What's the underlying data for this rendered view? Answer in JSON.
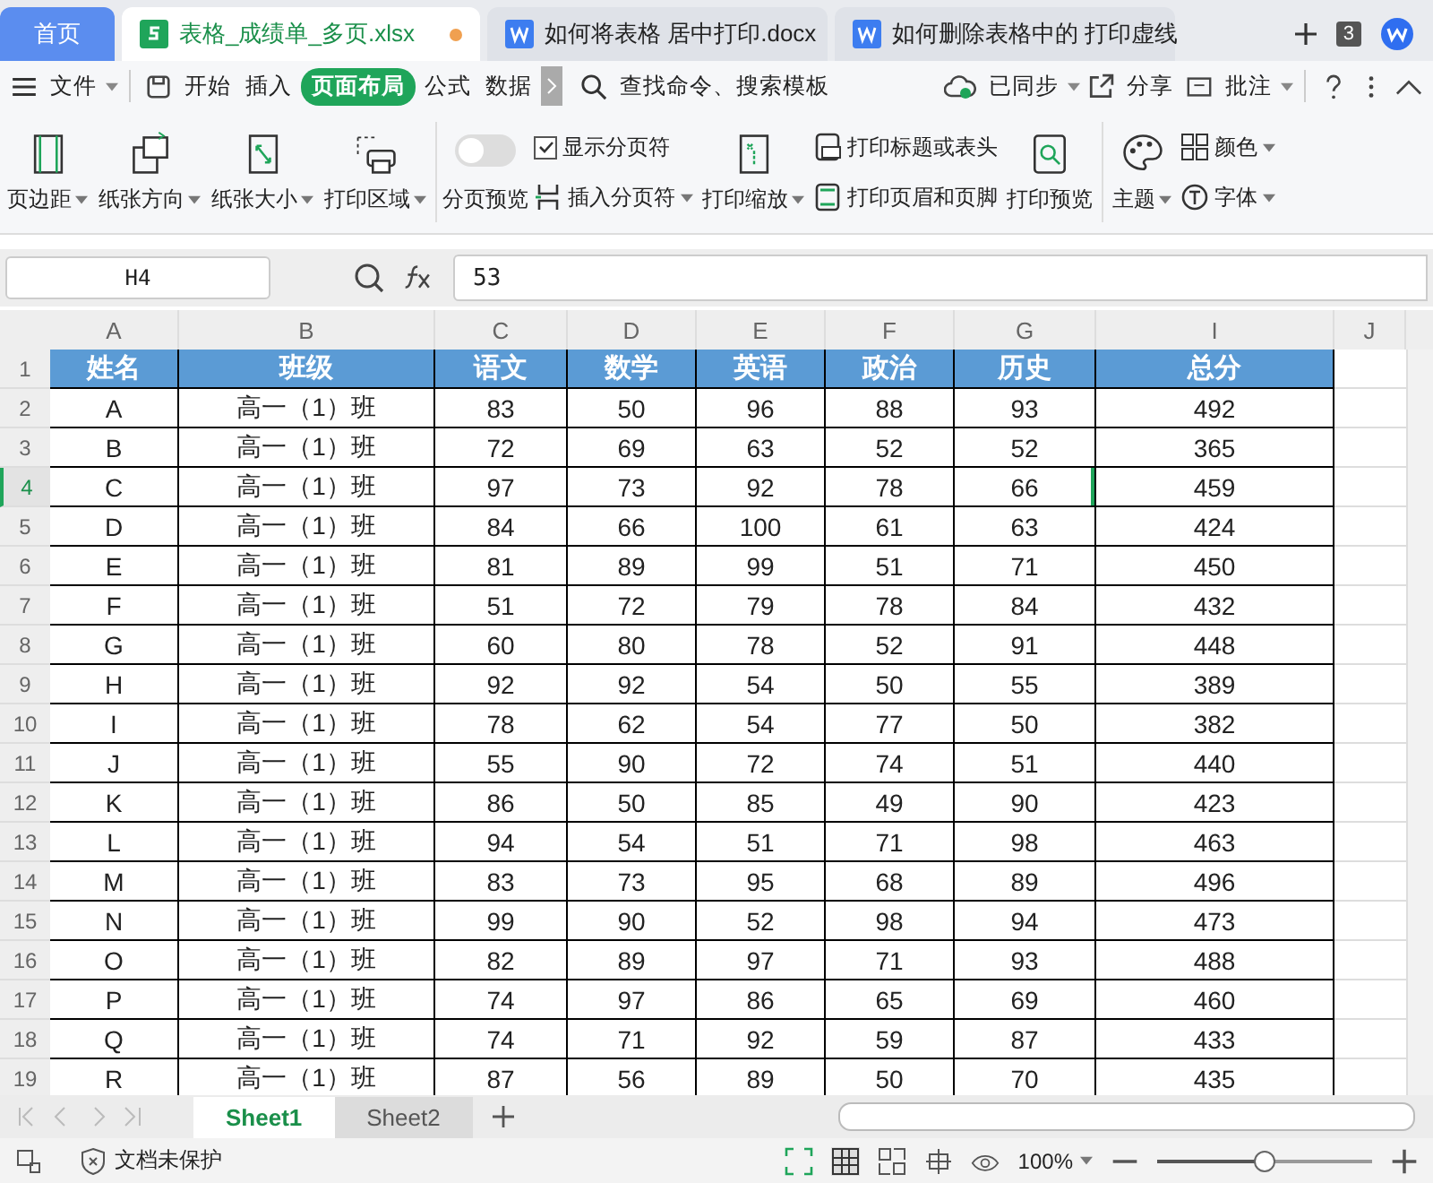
{
  "tabs": [
    {
      "label": "首页",
      "kind": "home",
      "selected": false,
      "modified": false
    },
    {
      "label": "表格_成绩单_多页.xlsx",
      "kind": "sheet",
      "selected": true,
      "modified": true
    },
    {
      "label": "如何将表格 居中打印.docx",
      "kind": "doc",
      "selected": false,
      "modified": false
    },
    {
      "label": "如何删除表格中的 打印虚线",
      "kind": "doc",
      "selected": false,
      "modified": false
    }
  ],
  "window_count": "3",
  "menu": {
    "file": "文件",
    "items": [
      {
        "label": "开始",
        "selected": false
      },
      {
        "label": "插入",
        "selected": false
      },
      {
        "label": "页面布局",
        "selected": true
      },
      {
        "label": "公式",
        "selected": false
      },
      {
        "label": "数据",
        "selected": false
      }
    ],
    "search": "查找命令、搜索模板",
    "sync": "已同步",
    "share": "分享",
    "comment": "批注"
  },
  "ribbon": {
    "page_setup": [
      "页边距",
      "纸张方向",
      "纸张大小",
      "打印区域"
    ],
    "page_break_preview": {
      "label": "分页预览",
      "on": false
    },
    "show_page_breaks": {
      "label": "显示分页符",
      "checked": true
    },
    "insert_page_break": "插入分页符",
    "print_scale": "打印缩放",
    "print_titles": "打印标题或表头",
    "print_header_footer": "打印页眉和页脚",
    "print_preview": "打印预览",
    "theme": "主题",
    "colors": "颜色",
    "fonts": "字体"
  },
  "formula_bar": {
    "name_box": "H4",
    "formula": "53"
  },
  "table": {
    "columns": [
      "A",
      "B",
      "C",
      "D",
      "E",
      "F",
      "G",
      "I",
      "J"
    ],
    "rows": [
      {
        "number": "1",
        "kind": "header",
        "selected": false,
        "cells": [
          "姓名",
          "班级",
          "语文",
          "数学",
          "英语",
          "政治",
          "历史",
          "总分"
        ]
      },
      {
        "number": "2",
        "kind": "data",
        "selected": false,
        "cells": [
          "A",
          "高一（1）班",
          "83",
          "50",
          "96",
          "88",
          "93",
          "492"
        ]
      },
      {
        "number": "3",
        "kind": "data",
        "selected": false,
        "cells": [
          "B",
          "高一（1）班",
          "72",
          "69",
          "63",
          "52",
          "52",
          "365"
        ]
      },
      {
        "number": "4",
        "kind": "data",
        "selected": true,
        "cells": [
          "C",
          "高一（1）班",
          "97",
          "73",
          "92",
          "78",
          "66",
          "459"
        ]
      },
      {
        "number": "5",
        "kind": "data",
        "selected": false,
        "cells": [
          "D",
          "高一（1）班",
          "84",
          "66",
          "100",
          "61",
          "63",
          "424"
        ]
      },
      {
        "number": "6",
        "kind": "data",
        "selected": false,
        "cells": [
          "E",
          "高一（1）班",
          "81",
          "89",
          "99",
          "51",
          "71",
          "450"
        ]
      },
      {
        "number": "7",
        "kind": "data",
        "selected": false,
        "cells": [
          "F",
          "高一（1）班",
          "51",
          "72",
          "79",
          "78",
          "84",
          "432"
        ]
      },
      {
        "number": "8",
        "kind": "data",
        "selected": false,
        "cells": [
          "G",
          "高一（1）班",
          "60",
          "80",
          "78",
          "52",
          "91",
          "448"
        ]
      },
      {
        "number": "9",
        "kind": "data",
        "selected": false,
        "cells": [
          "H",
          "高一（1）班",
          "92",
          "92",
          "54",
          "50",
          "55",
          "389"
        ]
      },
      {
        "number": "10",
        "kind": "data",
        "selected": false,
        "cells": [
          "I",
          "高一（1）班",
          "78",
          "62",
          "54",
          "77",
          "50",
          "382"
        ]
      },
      {
        "number": "11",
        "kind": "data",
        "selected": false,
        "cells": [
          "J",
          "高一（1）班",
          "55",
          "90",
          "72",
          "74",
          "51",
          "440"
        ]
      },
      {
        "number": "12",
        "kind": "data",
        "selected": false,
        "cells": [
          "K",
          "高一（1）班",
          "86",
          "50",
          "85",
          "49",
          "90",
          "423"
        ]
      },
      {
        "number": "13",
        "kind": "data",
        "selected": false,
        "cells": [
          "L",
          "高一（1）班",
          "94",
          "54",
          "51",
          "71",
          "98",
          "463"
        ]
      },
      {
        "number": "14",
        "kind": "data",
        "selected": false,
        "cells": [
          "M",
          "高一（1）班",
          "83",
          "73",
          "95",
          "68",
          "89",
          "496"
        ]
      },
      {
        "number": "15",
        "kind": "data",
        "selected": false,
        "cells": [
          "N",
          "高一（1）班",
          "99",
          "90",
          "52",
          "98",
          "94",
          "473"
        ]
      },
      {
        "number": "16",
        "kind": "data",
        "selected": false,
        "cells": [
          "O",
          "高一（1）班",
          "82",
          "89",
          "97",
          "71",
          "93",
          "488"
        ]
      },
      {
        "number": "17",
        "kind": "data",
        "selected": false,
        "cells": [
          "P",
          "高一（1）班",
          "74",
          "97",
          "86",
          "65",
          "69",
          "460"
        ]
      },
      {
        "number": "18",
        "kind": "data",
        "selected": false,
        "cells": [
          "Q",
          "高一（1）班",
          "74",
          "71",
          "92",
          "59",
          "87",
          "433"
        ]
      },
      {
        "number": "19",
        "kind": "data",
        "selected": false,
        "cells": [
          "R",
          "高一（1）班",
          "87",
          "56",
          "89",
          "50",
          "70",
          "435"
        ]
      }
    ]
  },
  "sheets": [
    {
      "label": "Sheet1",
      "selected": true
    },
    {
      "label": "Sheet2",
      "selected": false
    }
  ],
  "status_bar": {
    "protection": "文档未保护",
    "zoom": "100%",
    "zoom_level": {
      "level": 0.5
    }
  }
}
